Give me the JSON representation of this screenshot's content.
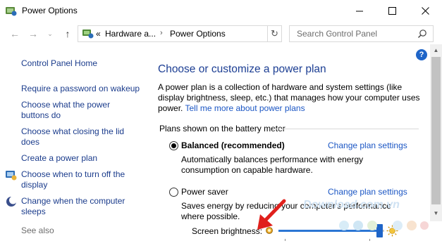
{
  "window": {
    "title": "Power Options",
    "minimize_icon": "minimize-icon",
    "maximize_icon": "maximize-icon",
    "close_icon": "close-icon"
  },
  "address": {
    "back_icon": "back-arrow-icon",
    "forward_icon": "forward-arrow-icon",
    "recent_icon": "chevron-down-icon",
    "up_icon": "up-arrow-icon",
    "overflow": "«",
    "crumbs": [
      "Hardware a...",
      "Power Options"
    ],
    "refresh_icon": "refresh-icon",
    "search_placeholder": "Search Control Panel"
  },
  "sidebar": {
    "home": "Control Panel Home",
    "links": [
      {
        "label_1": "Require a password on wakeup",
        "label_2": ""
      },
      {
        "label_1": "Choose what the power",
        "label_2": "buttons do"
      },
      {
        "label_1": "Choose what closing the lid",
        "label_2": "does"
      },
      {
        "label_1": "Create a power plan",
        "label_2": ""
      },
      {
        "label_1": "Choose when to turn off the",
        "label_2": "display"
      },
      {
        "label_1": "Change when the computer",
        "label_2": "sleeps"
      }
    ],
    "see_also": "See also"
  },
  "main": {
    "heading": "Choose or customize a power plan",
    "intro": "A power plan is a collection of hardware and system settings (like display brightness, sleep, etc.) that manages how your computer uses power.",
    "intro_link": "Tell me more about power plans",
    "group_label": "Plans shown on the battery meter",
    "plans": [
      {
        "name": "Balanced (recommended)",
        "selected": true,
        "link": "Change plan settings",
        "desc_1": "Automatically balances performance with energy",
        "desc_2": "consumption on capable hardware."
      },
      {
        "name": "Power saver",
        "selected": false,
        "link": "Change plan settings",
        "desc_1": "Saves energy by reducing your computer's performance",
        "desc_2": "where possible."
      }
    ]
  },
  "bottom": {
    "brightness_label": "Screen brightness:",
    "brightness_level": 0.95
  },
  "watermark": "Download.com.vn",
  "colors": {
    "link": "#1b56c4",
    "heading": "#1c3e93",
    "accent": "#1f65c8",
    "annotation_arrow": "#e0201c"
  }
}
